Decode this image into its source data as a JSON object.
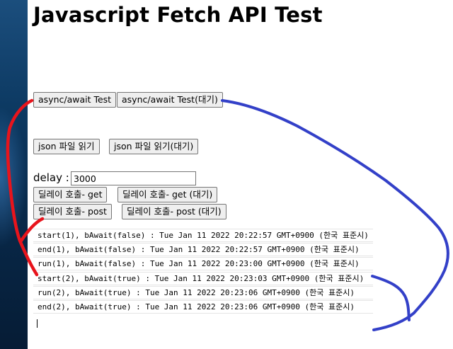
{
  "page": {
    "title": "Javascript Fetch API Test"
  },
  "buttons": {
    "async_test": "async/await Test",
    "async_test_wait": "async/await Test(대기)",
    "json_read": "json 파일 읽기",
    "json_read_wait": "json 파일 읽기(대기)",
    "delay_get": "딜레이 호출- get",
    "delay_get_wait": "딜레이 호출- get (대기)",
    "delay_post": "딜레이 호출- post",
    "delay_post_wait": "딜레이 호출- post (대기)"
  },
  "delay": {
    "label": "delay :",
    "value": "3000"
  },
  "log": [
    "start(1), bAwait(false) : Tue Jan 11 2022 20:22:57 GMT+0900 (한국 표준시)",
    "end(1), bAwait(false) : Tue Jan 11 2022 20:22:57 GMT+0900 (한국 표준시)",
    "run(1), bAwait(false) : Tue Jan 11 2022 20:23:00 GMT+0900 (한국 표준시)",
    "start(2), bAwait(true) : Tue Jan 11 2022 20:23:03 GMT+0900 (한국 표준시)",
    "run(2), bAwait(true) : Tue Jan 11 2022 20:23:06 GMT+0900 (한국 표준시)",
    "end(2), bAwait(true) : Tue Jan 11 2022 20:23:06 GMT+0900 (한국 표준시)"
  ],
  "annotation_colors": {
    "red": "#e8141c",
    "blue": "#3340c8"
  }
}
